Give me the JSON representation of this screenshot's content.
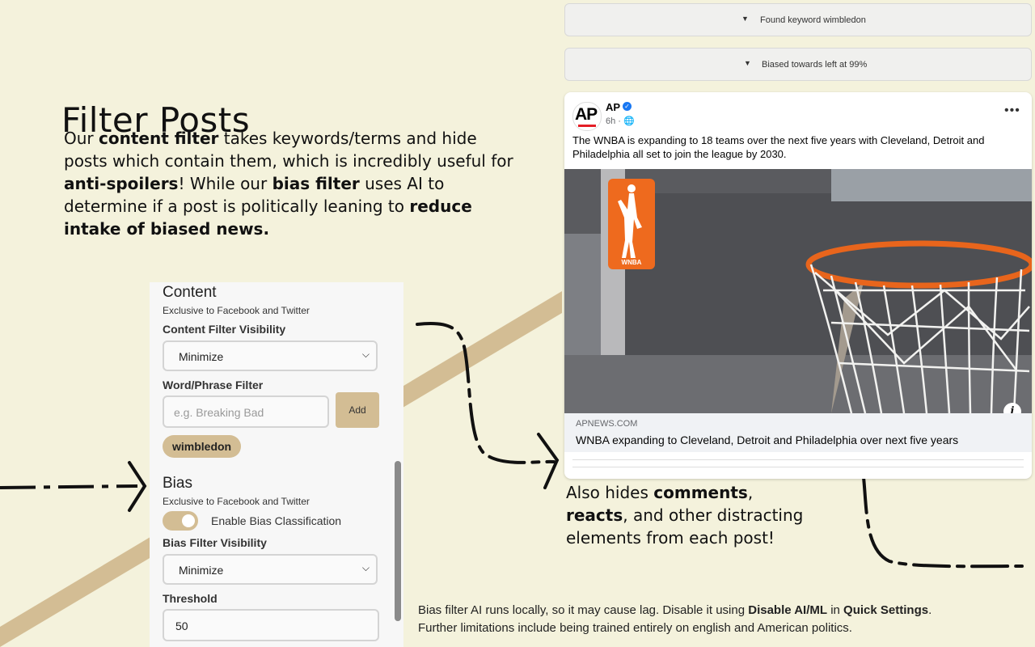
{
  "heading": "Filter Posts",
  "intro": {
    "p1": "Our ",
    "b1": "content filter",
    "p2": " takes keywords/terms and hide posts which contain them, which is incredibly useful for ",
    "b2": "anti-spoilers",
    "p3": "! While our ",
    "b3": "bias filter",
    "p4": " uses AI to determine if a post is politically leaning to ",
    "b4": "reduce intake of biased news."
  },
  "settings": {
    "content": {
      "title": "Content",
      "subtitle": "Exclusive to Facebook and Twitter",
      "visibility_label": "Content Filter Visibility",
      "visibility_value": "Minimize",
      "word_filter_label": "Word/Phrase Filter",
      "word_filter_placeholder": "e.g. Breaking Bad",
      "add_label": "Add",
      "keywords": [
        "wimbledon"
      ]
    },
    "bias": {
      "title": "Bias",
      "subtitle": "Exclusive to Facebook and Twitter",
      "toggle_label": "Enable Bias Classification",
      "toggle_on": true,
      "visibility_label": "Bias Filter Visibility",
      "visibility_value": "Minimize",
      "threshold_label": "Threshold",
      "threshold_value": "50"
    }
  },
  "feed": {
    "collapsed_1": "Found keyword wimbledon",
    "collapsed_2": "Biased towards left at 99%",
    "post": {
      "logo_text": "AP",
      "page_name": "AP",
      "time": "6h · ",
      "text": "The WNBA is expanding to 18 teams over the next five years with Cleveland, Detroit and Philadelphia all set to join the league by 2030.",
      "photo_badge": "WNBA",
      "link_domain": "APNEWS.COM",
      "link_title": "WNBA expanding to Cleveland, Detroit and Philadelphia over next five years"
    }
  },
  "also": {
    "p1": "Also hides ",
    "b1": "comments",
    "p2": ", ",
    "b2": "reacts",
    "p3": ", and other distracting elements from each post!"
  },
  "footer": {
    "p1": "Bias filter AI runs locally, so it may cause lag. Disable it using ",
    "b1": "Disable AI/ML",
    "p2": " in ",
    "b2": "Quick Settings",
    "p3": ".",
    "line2": "Further limitations include being trained entirely on english and American politics."
  },
  "colors": {
    "background": "#f4f2dc",
    "accent": "#d3bd94",
    "verified": "#1877f2"
  }
}
